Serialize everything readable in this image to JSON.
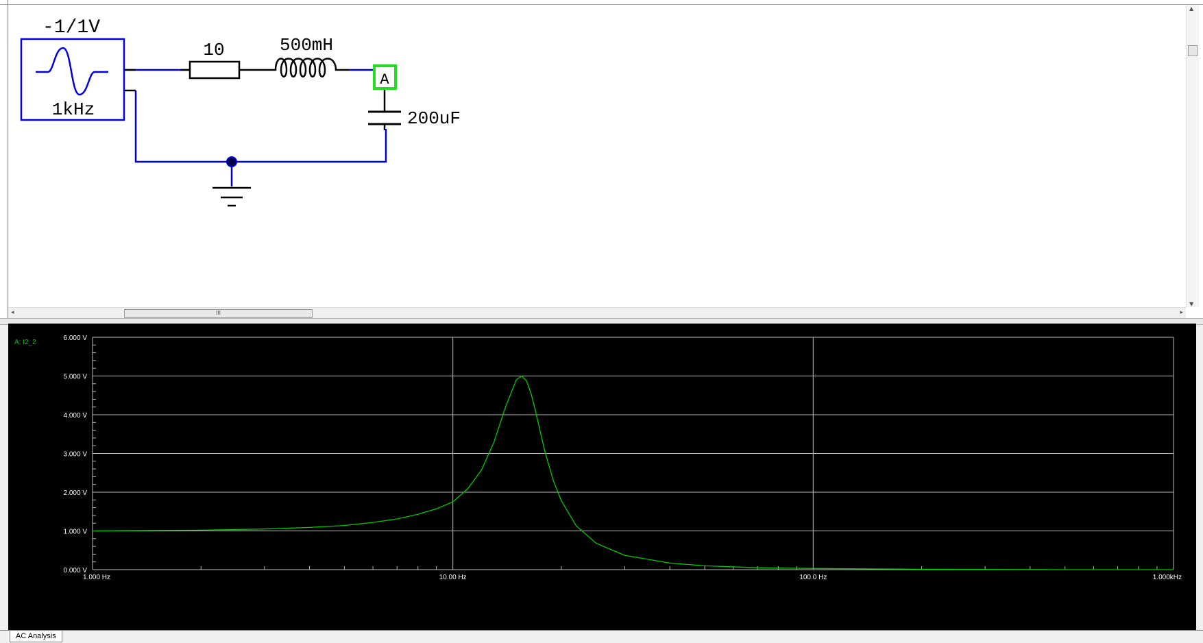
{
  "schematic": {
    "source_amplitude": "-1/1V",
    "source_frequency": "1kHz",
    "resistor_value": "10",
    "inductor_value": "500mH",
    "capacitor_value": "200uF",
    "probe_label": "A",
    "wire_color": "#0000dd",
    "probe_color": "#22dd22"
  },
  "scrollbar": {
    "thumb_grip": "III"
  },
  "tabs": [
    {
      "label": "AC Analysis"
    }
  ],
  "chart_data": {
    "type": "line",
    "trace_label": "A: I2_2",
    "trace_color": "#00cc00",
    "background": "#000000",
    "x_scale": "log",
    "xlim": [
      1,
      1000
    ],
    "ylim": [
      0,
      6
    ],
    "x_ticks": [
      {
        "value": 1,
        "label": "1.000 Hz"
      },
      {
        "value": 10,
        "label": "10.00 Hz"
      },
      {
        "value": 100,
        "label": "100.0 Hz"
      },
      {
        "value": 1000,
        "label": "1.000kHz"
      }
    ],
    "y_ticks": [
      {
        "value": 0,
        "label": "0.000 V"
      },
      {
        "value": 1,
        "label": "1.000 V"
      },
      {
        "value": 2,
        "label": "2.000 V"
      },
      {
        "value": 3,
        "label": "3.000 V"
      },
      {
        "value": 4,
        "label": "4.000 V"
      },
      {
        "value": 5,
        "label": "5.000 V"
      },
      {
        "value": 6,
        "label": "6.000 V"
      }
    ],
    "grid": true,
    "series": [
      {
        "name": "A: I2_2",
        "x": [
          1,
          2,
          3,
          4,
          5,
          6,
          7,
          8,
          9,
          10,
          11,
          12,
          13,
          14,
          15,
          15.5,
          16,
          16.5,
          17,
          18,
          19,
          20,
          22,
          25,
          30,
          40,
          50,
          70,
          100,
          200,
          500,
          1000
        ],
        "y": [
          1.0,
          1.02,
          1.05,
          1.09,
          1.14,
          1.22,
          1.31,
          1.43,
          1.57,
          1.75,
          2.09,
          2.57,
          3.29,
          4.2,
          4.9,
          5.0,
          4.88,
          4.53,
          4.05,
          3.05,
          2.3,
          1.78,
          1.13,
          0.68,
          0.37,
          0.17,
          0.1,
          0.05,
          0.03,
          0.01,
          0.0,
          0.0
        ]
      }
    ]
  }
}
